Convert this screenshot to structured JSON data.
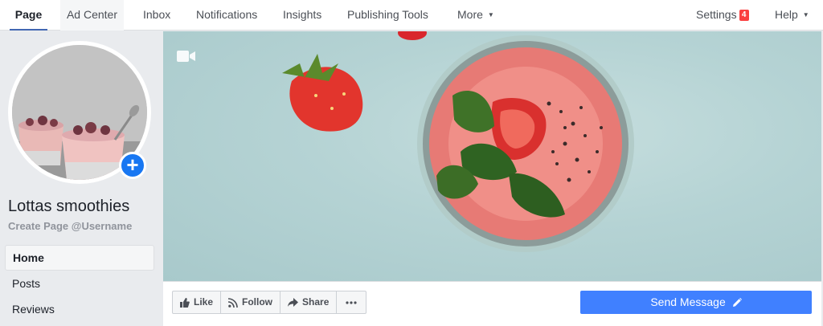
{
  "nav": {
    "tabs": [
      {
        "label": "Page"
      },
      {
        "label": "Ad Center"
      },
      {
        "label": "Inbox"
      },
      {
        "label": "Notifications"
      },
      {
        "label": "Insights"
      },
      {
        "label": "Publishing Tools"
      },
      {
        "label": "More"
      }
    ],
    "settings_label": "Settings",
    "settings_badge": "4",
    "help_label": "Help"
  },
  "page": {
    "name": "Lottas smoothies",
    "username_prompt": "Create Page @Username"
  },
  "sidebar": {
    "items": [
      {
        "label": "Home"
      },
      {
        "label": "Posts"
      },
      {
        "label": "Reviews"
      }
    ]
  },
  "actions": {
    "like": "Like",
    "follow": "Follow",
    "share": "Share",
    "send_message": "Send Message"
  },
  "icons": {
    "cover_video": "video-camera-icon",
    "add_photo": "plus-icon",
    "like": "thumbs-up-icon",
    "follow": "rss-icon",
    "share": "share-arrow-icon",
    "more": "ellipsis-icon",
    "send": "pencil-icon"
  },
  "colors": {
    "accent": "#4267b2",
    "send_button": "#4080ff",
    "badge": "#fa3e3e",
    "add_photo": "#1877f2"
  }
}
